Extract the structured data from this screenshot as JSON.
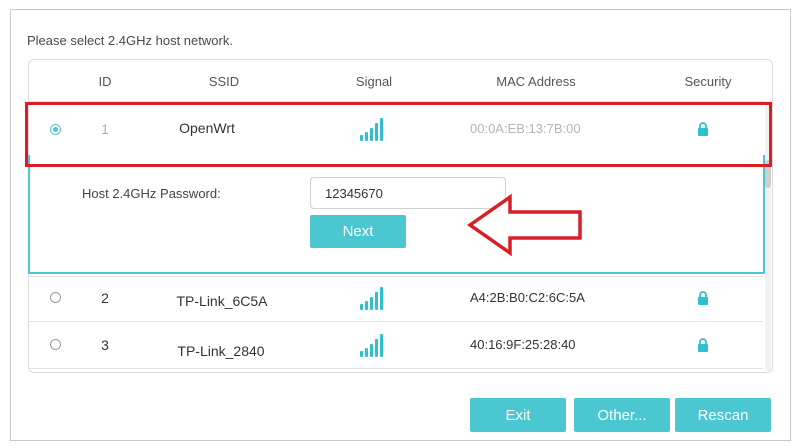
{
  "dialog": {
    "prompt": "Please select 2.4GHz host network."
  },
  "table": {
    "columns": {
      "id": "ID",
      "ssid": "SSID",
      "signal": "Signal",
      "mac": "MAC Address",
      "security": "Security"
    },
    "rows": [
      {
        "id": "1",
        "ssid": "OpenWrt",
        "mac": "00:0A:EB:13:7B:00",
        "selected": true,
        "signal_icon": "signal-strong-icon",
        "security_icon": "lock-icon"
      },
      {
        "id": "2",
        "ssid": "TP-Link_6C5A",
        "mac": "A4:2B:B0:C2:6C:5A",
        "selected": false,
        "signal_icon": "signal-strong-icon",
        "security_icon": "lock-icon"
      },
      {
        "id": "3",
        "ssid": "TP-Link_2840",
        "mac": "40:16:9F:25:28:40",
        "selected": false,
        "signal_icon": "signal-strong-icon",
        "security_icon": "lock-icon"
      }
    ]
  },
  "password_panel": {
    "label": "Host 2.4GHz Password:",
    "value": "12345670",
    "next_label": "Next"
  },
  "footer": {
    "exit_label": "Exit",
    "other_label": "Other...",
    "rescan_label": "Rescan"
  },
  "colors": {
    "accent": "#4ac7d1",
    "annotation": "#d91f26"
  }
}
